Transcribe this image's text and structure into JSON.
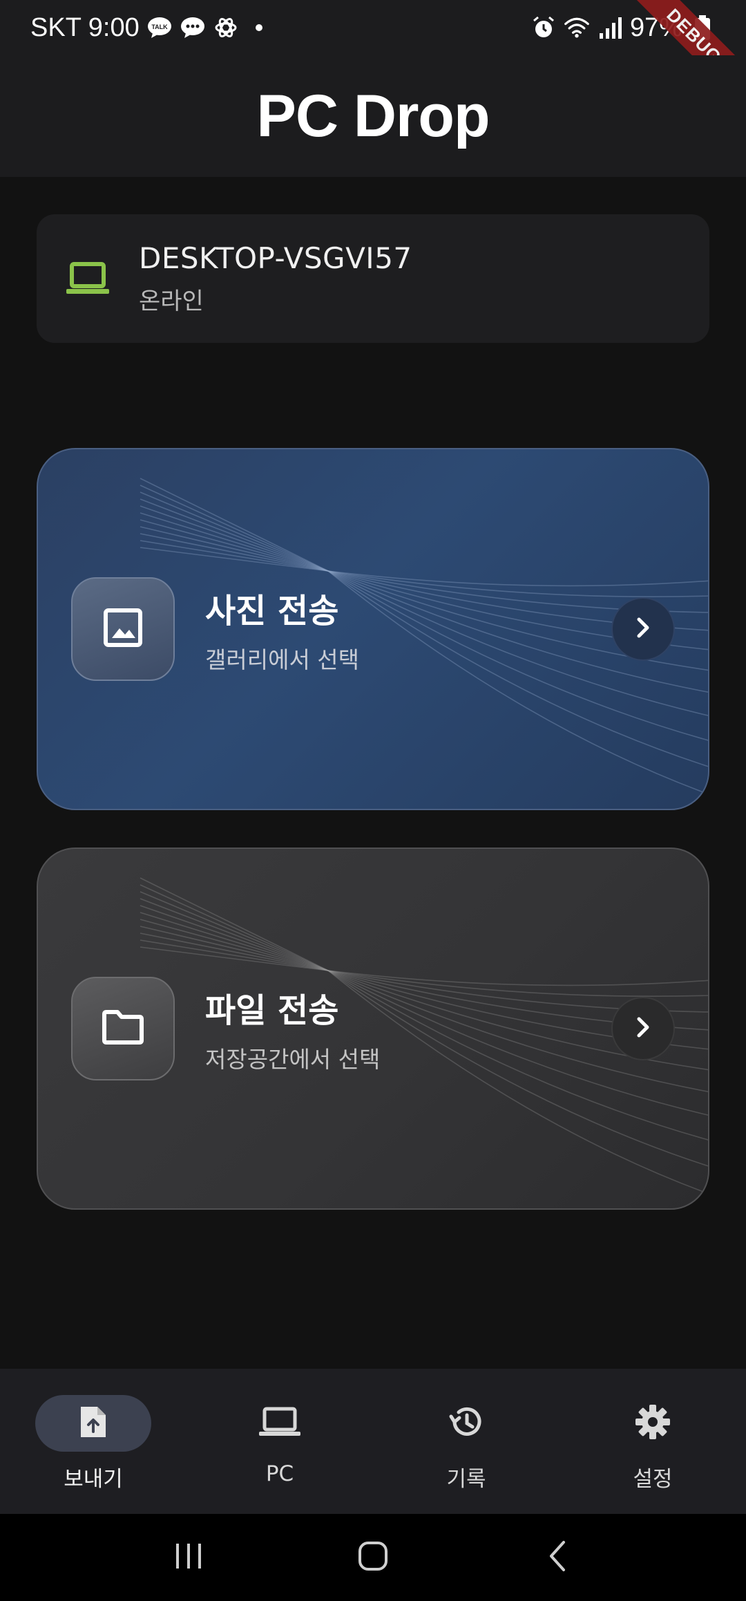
{
  "status_bar": {
    "carrier_time": "SKT 9:00",
    "battery": "97%",
    "debug_label": "DEBUG",
    "notification_icons": [
      "talk-icon",
      "message-icon",
      "openai-icon",
      "dot-icon"
    ],
    "system_icons": [
      "alarm-icon",
      "wifi-icon",
      "signal-icon",
      "battery-icon"
    ]
  },
  "app_bar": {
    "title": "PC Drop"
  },
  "device": {
    "name": "DESKTOP-VSGVI57",
    "status": "온라인",
    "icon": "laptop-icon",
    "accent_color": "#8bc34a"
  },
  "actions": [
    {
      "title": "사진 전송",
      "subtitle": "갤러리에서 선택",
      "icon": "image-icon"
    },
    {
      "title": "파일 전송",
      "subtitle": "저장공간에서 선택",
      "icon": "folder-icon"
    }
  ],
  "bottom_nav": {
    "items": [
      {
        "label": "보내기",
        "icon": "file-upload-icon",
        "active": true
      },
      {
        "label": "PC",
        "icon": "laptop-icon",
        "active": false
      },
      {
        "label": "기록",
        "icon": "history-icon",
        "active": false
      },
      {
        "label": "설정",
        "icon": "settings-icon",
        "active": false
      }
    ]
  },
  "system_nav": [
    "recents-icon",
    "home-icon",
    "back-icon"
  ]
}
